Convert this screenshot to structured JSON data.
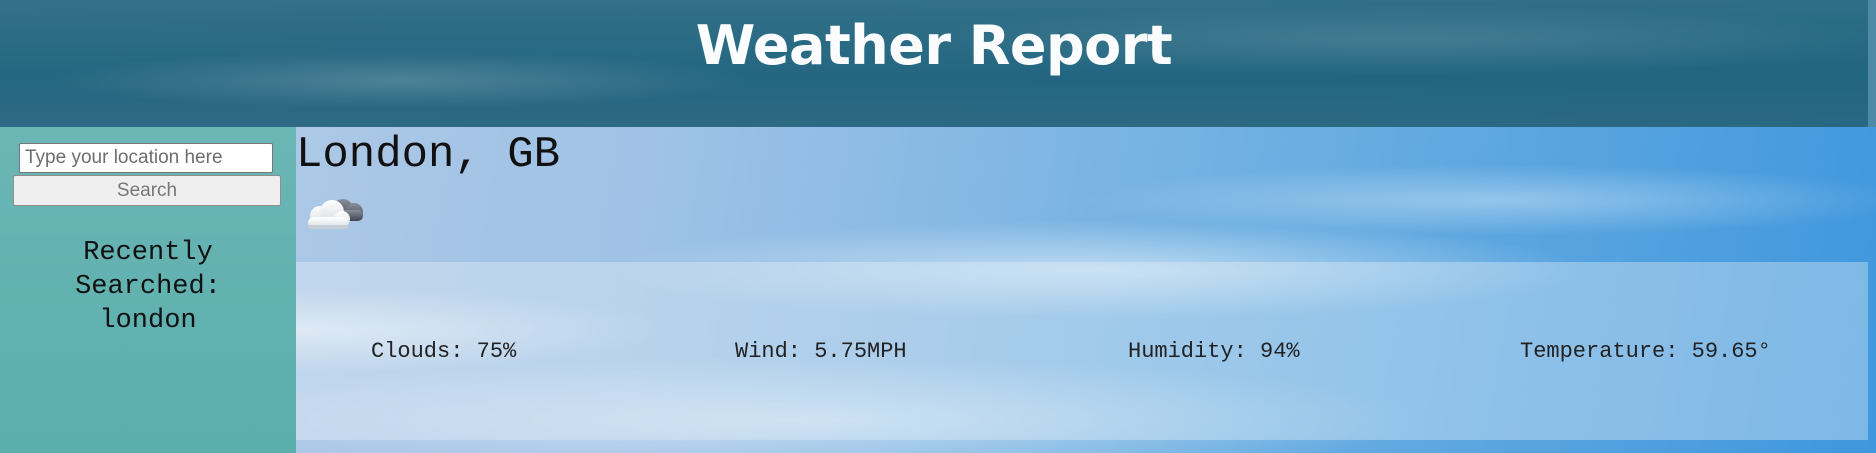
{
  "header": {
    "title": "Weather Report"
  },
  "search": {
    "placeholder": "Type your location here",
    "button_label": "Search"
  },
  "recent": {
    "title": "Recently Searched:",
    "items": [
      "london"
    ]
  },
  "location": {
    "name": "London, GB",
    "weather_icon": "cloud-icon"
  },
  "stats": {
    "clouds": "Clouds: 75%",
    "wind": "Wind: 5.75MPH",
    "humidity": "Humidity: 94%",
    "temperature": "Temperature: 59.65°"
  },
  "colors": {
    "header_bg": "#21647e",
    "sidebar_bg": "#5aaeac",
    "title_text": "#ffffff"
  }
}
